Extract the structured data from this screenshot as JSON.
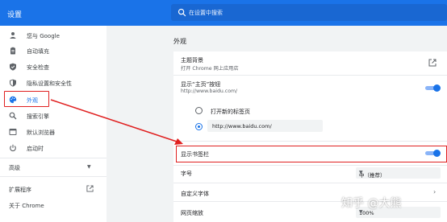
{
  "header": {
    "title": "设置",
    "search_placeholder": "在设置中搜索"
  },
  "sidebar": {
    "items": [
      {
        "label": "您与 Google",
        "icon": "person-icon"
      },
      {
        "label": "自动填充",
        "icon": "clipboard-icon"
      },
      {
        "label": "安全检查",
        "icon": "shield-check-icon"
      },
      {
        "label": "隐私设置和安全性",
        "icon": "shield-icon"
      },
      {
        "label": "外观",
        "icon": "palette-icon",
        "active": true
      },
      {
        "label": "搜索引擎",
        "icon": "search-icon"
      },
      {
        "label": "默认浏览器",
        "icon": "browser-icon"
      },
      {
        "label": "启动时",
        "icon": "power-icon"
      }
    ],
    "advanced": "高级",
    "extensions": "扩展程序",
    "about": "关于 Chrome"
  },
  "main": {
    "section_title": "外观",
    "theme": {
      "title": "主题背景",
      "subtitle": "打开 Chrome 网上应用店"
    },
    "home_button": {
      "title": "显示“主页”按钮",
      "subtitle": "http://www.baidu.com/",
      "enabled": true
    },
    "home_options": {
      "new_tab": "打开新的标签页",
      "custom_url": "http://www.baidu.com/",
      "selected": "custom"
    },
    "bookmarks_bar": {
      "title": "显示书签栏",
      "enabled": true
    },
    "font_size": {
      "title": "字号",
      "value": "中（推荐）"
    },
    "custom_fonts": {
      "title": "自定义字体"
    },
    "page_zoom": {
      "title": "网页缩放",
      "value": "100%"
    }
  },
  "watermark": "知乎 @大熊",
  "colors": {
    "accent": "#1a73e8",
    "annotation": "#e02020"
  }
}
